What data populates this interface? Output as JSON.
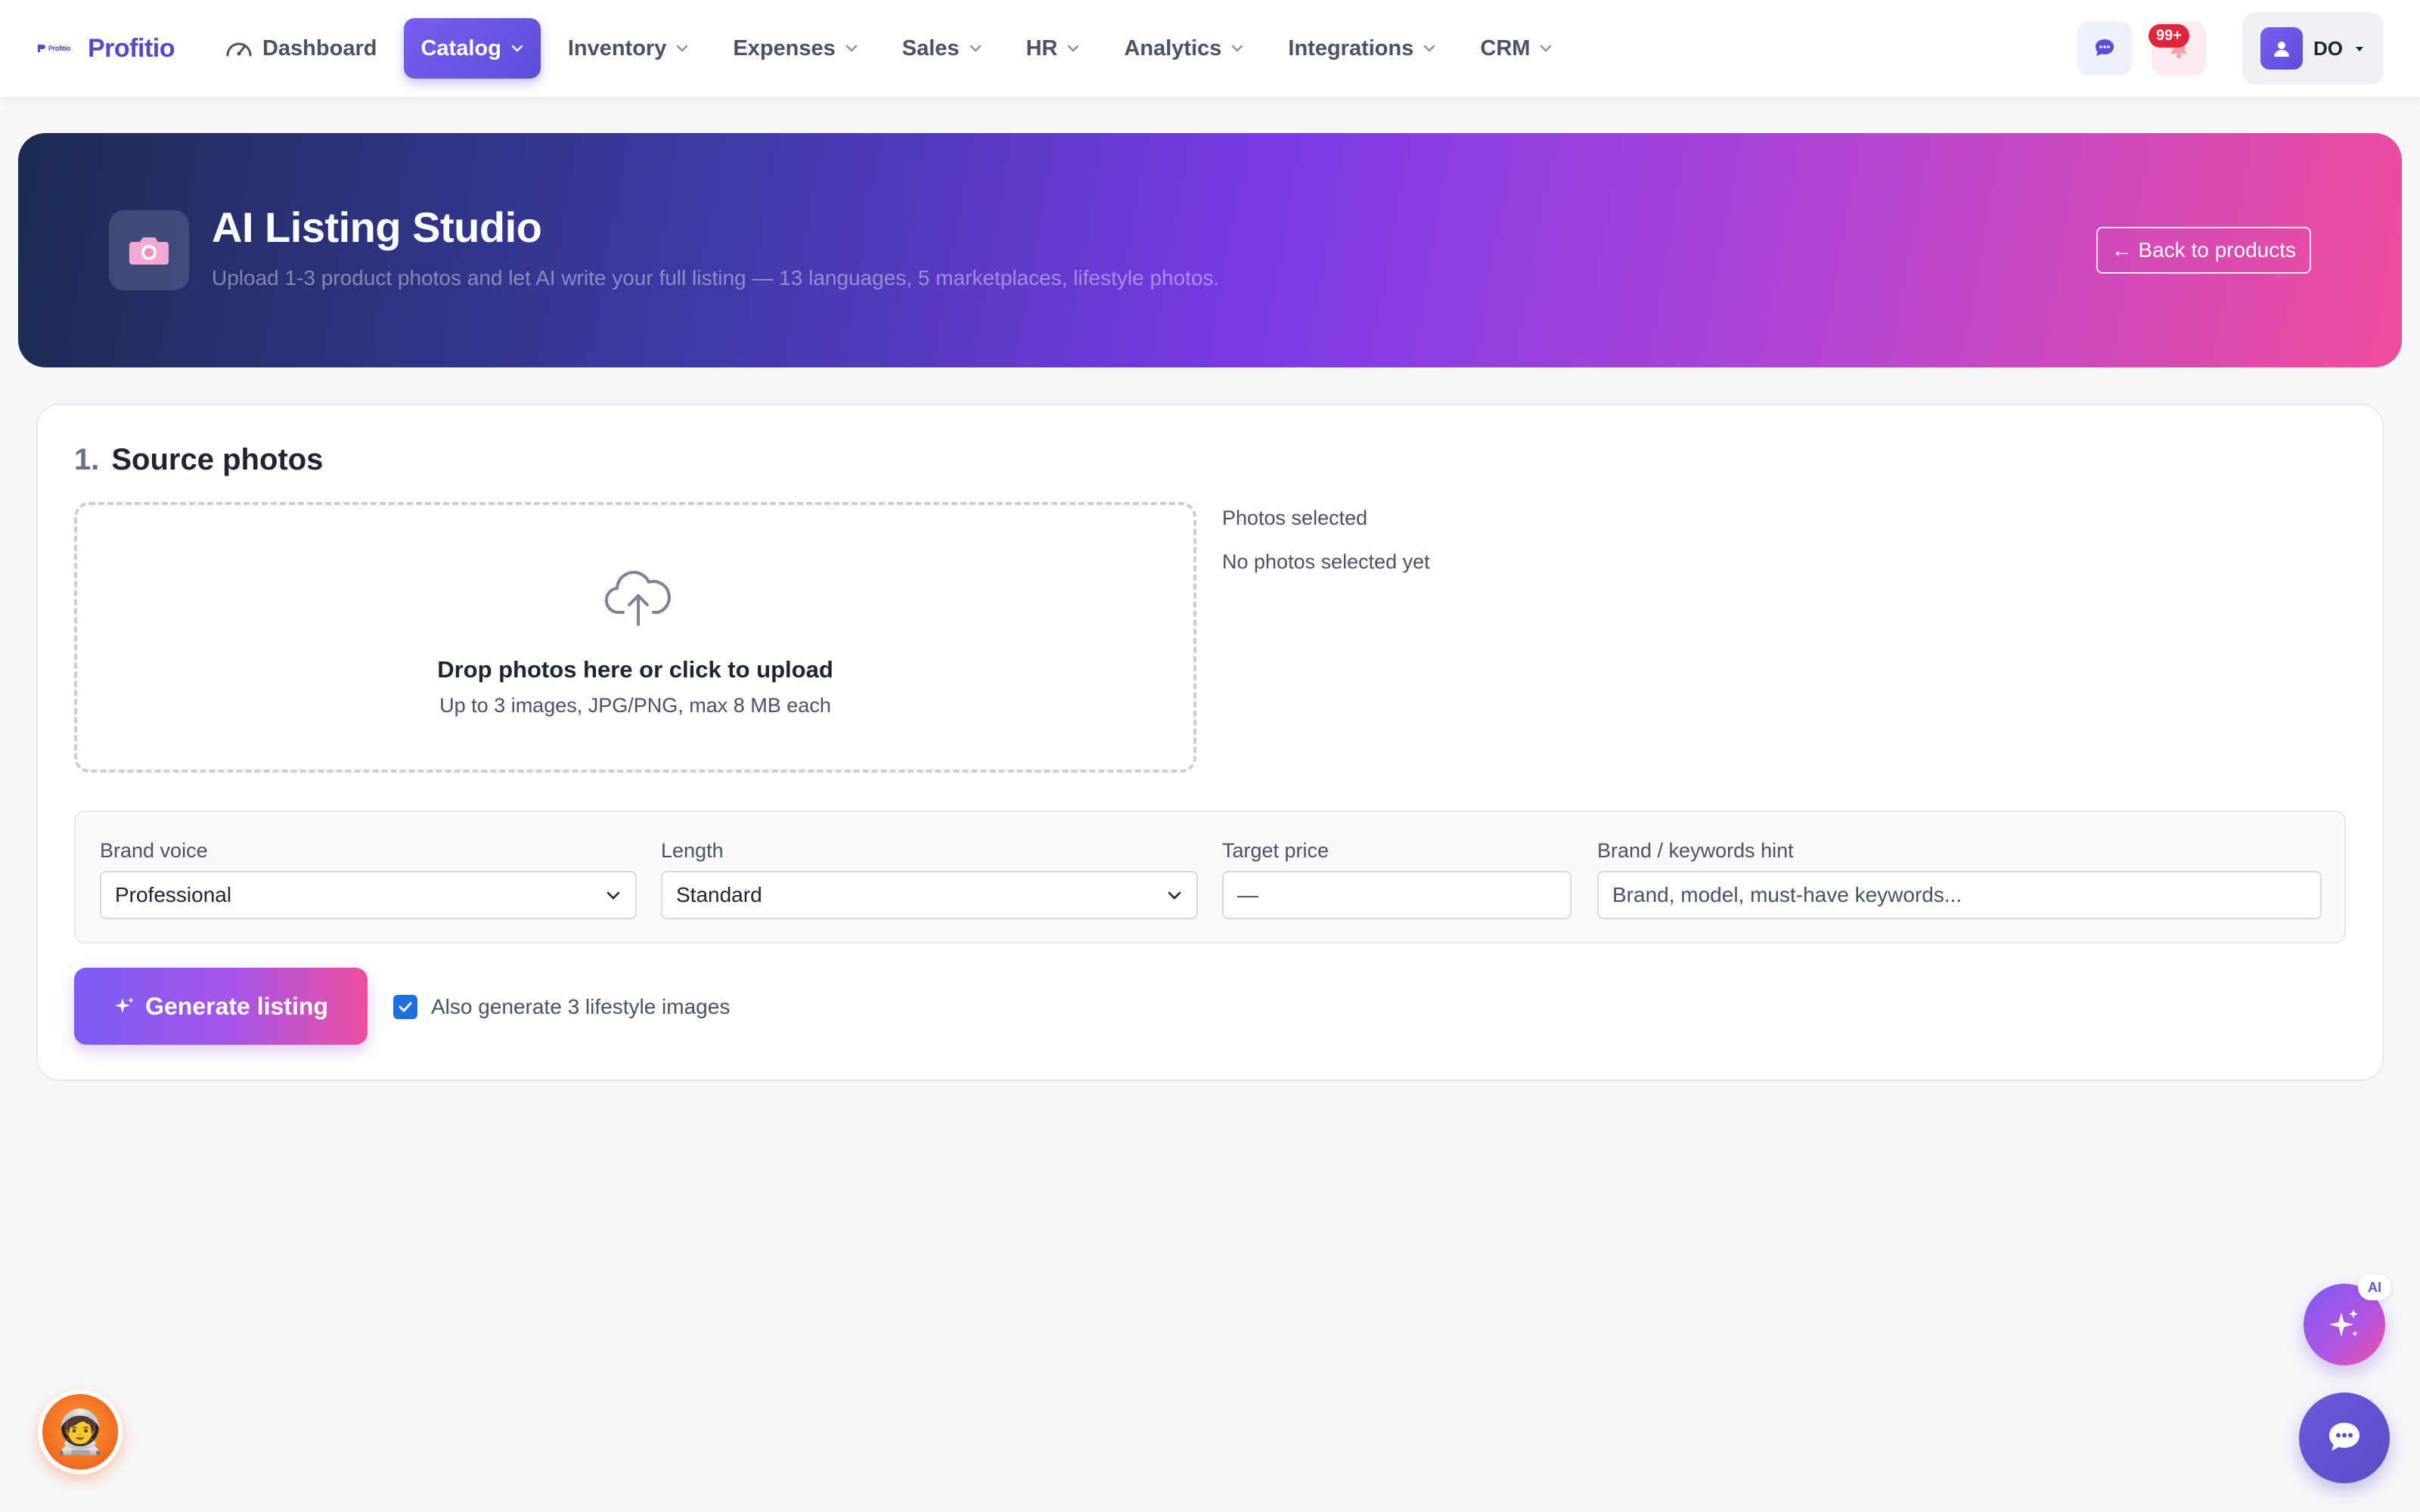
{
  "brand": {
    "mini": "Profitio",
    "name": "Profitio"
  },
  "nav": {
    "items": [
      {
        "label": "Dashboard"
      },
      {
        "label": "Catalog"
      },
      {
        "label": "Inventory"
      },
      {
        "label": "Expenses"
      },
      {
        "label": "Sales"
      },
      {
        "label": "HR"
      },
      {
        "label": "Analytics"
      },
      {
        "label": "Integrations"
      },
      {
        "label": "CRM"
      }
    ],
    "active": "Catalog",
    "notifications_badge": "99+",
    "user_initials": "DO"
  },
  "hero": {
    "title": "AI Listing Studio",
    "subtitle": "Upload 1-3 product photos and let AI write your full listing — 13 languages, 5 marketplaces, lifestyle photos.",
    "back_label": "← Back to products"
  },
  "source": {
    "step_num": "1.",
    "title": "Source photos",
    "drop_title": "Drop photos here or click to upload",
    "drop_sub": "Up to 3 images, JPG/PNG, max 8 MB each",
    "photos_label": "Photos selected",
    "photos_empty": "No photos selected yet"
  },
  "form": {
    "brand_voice_label": "Brand voice",
    "brand_voice_value": "Professional",
    "length_label": "Length",
    "length_value": "Standard",
    "price_label": "Target price",
    "price_placeholder": "—",
    "hint_label": "Brand / keywords hint",
    "hint_placeholder": "Brand, model, must-have keywords..."
  },
  "actions": {
    "generate_label": "Generate listing",
    "lifestyle_label": "Also generate 3 lifestyle images",
    "lifestyle_checked": true
  },
  "floating": {
    "ai_tag": "AI",
    "mascot": "🧑‍🚀"
  },
  "colors": {
    "accent": "#5a4fd8",
    "hero_start": "#1c2b52",
    "hero_end": "#ef4d9c",
    "badge": "#e0263c",
    "checkbox": "#1f6fe0"
  }
}
